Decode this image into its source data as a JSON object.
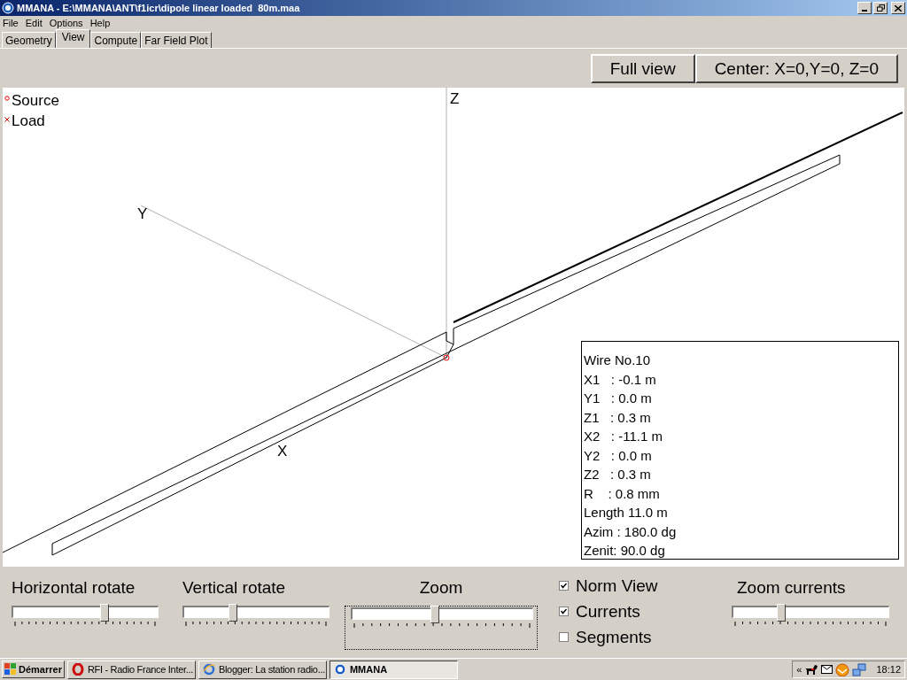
{
  "window": {
    "title": "MMANA - E:\\MMANA\\ANT\\f1icr\\dipole linear loaded  80m.maa"
  },
  "menu": [
    "File",
    "Edit",
    "Options",
    "Help"
  ],
  "tabs": [
    {
      "label": "Geometry",
      "selected": false
    },
    {
      "label": "View",
      "selected": true
    },
    {
      "label": "Compute",
      "selected": false
    },
    {
      "label": "Far Field Plot",
      "selected": false
    }
  ],
  "view_buttons": [
    "Full view",
    "Center: X=0,Y=0, Z=0"
  ],
  "legend": [
    {
      "kind": "source",
      "label": "Source"
    },
    {
      "kind": "load",
      "label": "Load"
    }
  ],
  "axis_labels": [
    {
      "kind": "z",
      "label": "Z"
    },
    {
      "kind": "y",
      "label": "Y"
    },
    {
      "kind": "x",
      "label": "X"
    }
  ],
  "wire_info": [
    "Wire No.10",
    "X1   : -0.1 m",
    "Y1   : 0.0 m",
    "Z1   : 0.3 m",
    "X2   : -11.1 m",
    "Y2   : 0.0 m",
    "Z2   : 0.3 m",
    "R    : 0.8 mm",
    "Length 11.0 m",
    "Azim : 180.0 dg",
    "Zenit: 90.0 dg"
  ],
  "sliders": [
    {
      "label": "Horizontal rotate",
      "level": 0.63,
      "focused": false
    },
    {
      "label": "Vertical rotate",
      "level": 0.34,
      "focused": false
    },
    {
      "label": "Zoom",
      "level": 0.46,
      "focused": true
    }
  ],
  "checkboxes": [
    {
      "label": "Norm View",
      "checked": true
    },
    {
      "label": "Currents",
      "checked": true
    },
    {
      "label": "Segments",
      "checked": false
    }
  ],
  "zoom_currents": {
    "label": "Zoom currents",
    "level": 0.31
  },
  "taskbar": {
    "start": "Démarrer",
    "tasks": [
      {
        "kind": "opera",
        "label": "RFI - Radio France Inter...",
        "selected": false
      },
      {
        "kind": "ie",
        "label": "Blogger: La station radio...",
        "selected": false
      },
      {
        "kind": "mmana",
        "label": "MMANA",
        "selected": true
      }
    ],
    "tray_toggle": "«",
    "time": "18:12"
  }
}
